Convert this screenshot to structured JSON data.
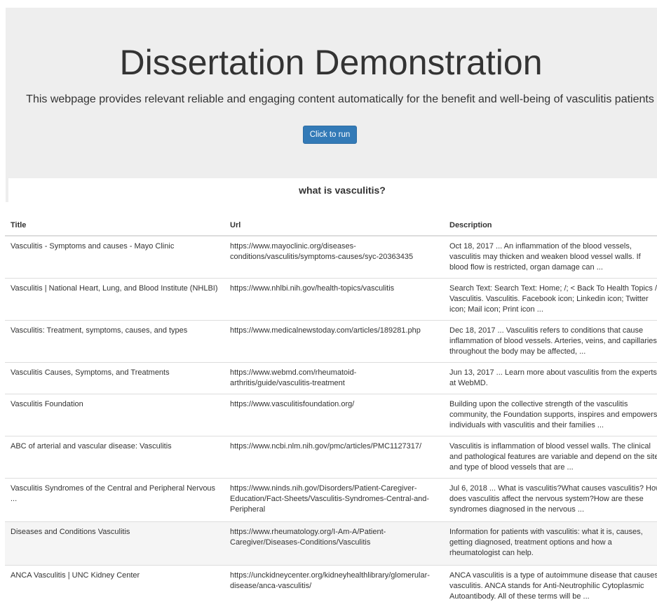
{
  "header": {
    "title": "Dissertation Demonstration",
    "lead": "This webpage provides relevant reliable and engaging content automatically for the benefit and well-being of vasculitis patients",
    "run_button_label": "Click to run"
  },
  "query": {
    "text": "what is vasculitis?"
  },
  "table": {
    "columns": [
      "Title",
      "Url",
      "Description"
    ],
    "rows": [
      {
        "title": "Vasculitis - Symptoms and causes - Mayo Clinic",
        "url": "https://www.mayoclinic.org/diseases-conditions/vasculitis/symptoms-causes/syc-20363435",
        "description": "Oct 18, 2017 ... An inflammation of the blood vessels, vasculitis may thicken and weaken blood vessel walls. If blood flow is restricted, organ damage can ..."
      },
      {
        "title": "Vasculitis | National Heart, Lung, and Blood Institute (NHLBI)",
        "url": "https://www.nhlbi.nih.gov/health-topics/vasculitis",
        "description": "Search Text: Search Text: Home; /; < Back To Health Topics /; Vasculitis. Vasculitis. Facebook icon; Linkedin icon; Twitter icon; Mail icon; Print icon ..."
      },
      {
        "title": "Vasculitis: Treatment, symptoms, causes, and types",
        "url": "https://www.medicalnewstoday.com/articles/189281.php",
        "description": "Dec 18, 2017 ... Vasculitis refers to conditions that cause inflammation of blood vessels. Arteries, veins, and capillaries throughout the body may be affected, ..."
      },
      {
        "title": "Vasculitis Causes, Symptoms, and Treatments",
        "url": "https://www.webmd.com/rheumatoid-arthritis/guide/vasculitis-treatment",
        "description": "Jun 13, 2017 ... Learn more about vasculitis from the experts at WebMD."
      },
      {
        "title": "Vasculitis Foundation",
        "url": "https://www.vasculitisfoundation.org/",
        "description": "Building upon the collective strength of the vasculitis community, the Foundation supports, inspires and empowers individuals with vasculitis and their families ..."
      },
      {
        "title": "ABC of arterial and vascular disease: Vasculitis",
        "url": "https://www.ncbi.nlm.nih.gov/pmc/articles/PMC1127317/",
        "description": "Vasculitis is inflammation of blood vessel walls. The clinical and pathological features are variable and depend on the site and type of blood vessels that are ..."
      },
      {
        "title": "Vasculitis Syndromes of the Central and Peripheral Nervous ...",
        "url": "https://www.ninds.nih.gov/Disorders/Patient-Caregiver-Education/Fact-Sheets/Vasculitis-Syndromes-Central-and-Peripheral",
        "description": "Jul 6, 2018 ... What is vasculitis?What causes vasculitis? How does vasculitis affect the nervous system?How are these syndromes diagnosed in the nervous ..."
      },
      {
        "title": "Diseases and Conditions Vasculitis",
        "url": "https://www.rheumatology.org/I-Am-A/Patient-Caregiver/Diseases-Conditions/Vasculitis",
        "description": "Information for patients with vasculitis: what it is, causes, getting diagnosed, treatment options and how a rheumatologist can help."
      },
      {
        "title": "ANCA Vasculitis | UNC Kidney Center",
        "url": "https://unckidneycenter.org/kidneyhealthlibrary/glomerular-disease/anca-vasculitis/",
        "description": "ANCA vasculitis is a type of autoimmune disease that causes vasculitis. ANCA stands for Anti-Neutrophilic Cytoplasmic Autoantibody. All of these terms will be ..."
      }
    ]
  }
}
